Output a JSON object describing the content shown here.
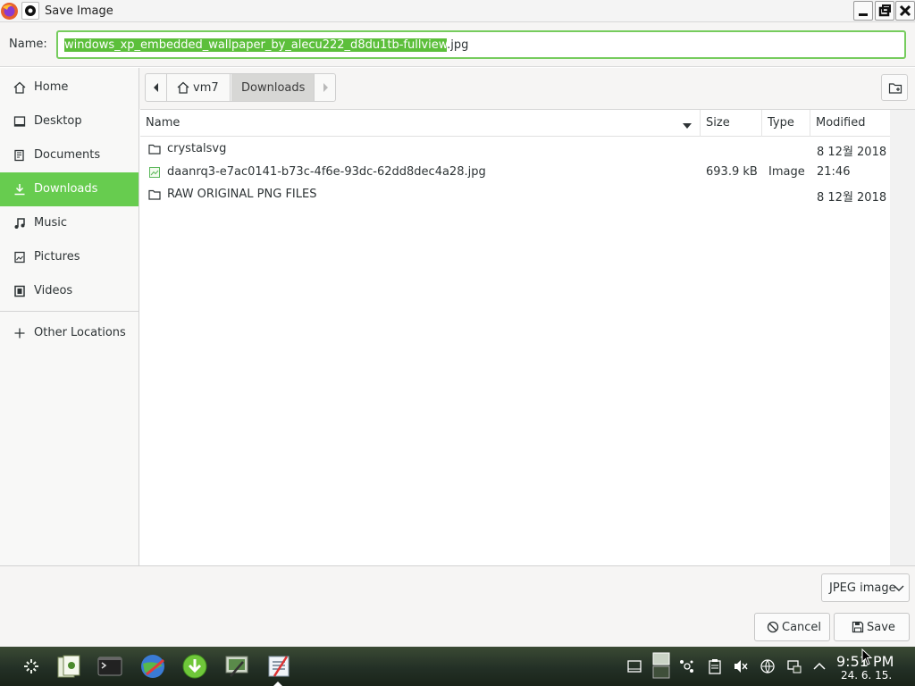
{
  "window": {
    "title": "Save Image"
  },
  "name_field": {
    "label": "Name:",
    "value_selected": "windows_xp_embedded_wallpaper_by_alecu222_d8du1tb-fullview",
    "value_rest": ".jpg"
  },
  "sidebar": {
    "items": [
      {
        "label": "Home",
        "icon": "home-icon"
      },
      {
        "label": "Desktop",
        "icon": "desktop-icon"
      },
      {
        "label": "Documents",
        "icon": "documents-icon"
      },
      {
        "label": "Downloads",
        "icon": "downloads-icon",
        "active": true
      },
      {
        "label": "Music",
        "icon": "music-icon"
      },
      {
        "label": "Pictures",
        "icon": "pictures-icon"
      },
      {
        "label": "Videos",
        "icon": "videos-icon"
      },
      {
        "label": "Other Locations",
        "icon": "plus-icon"
      }
    ]
  },
  "pathbar": {
    "home_label": "vm7",
    "current_label": "Downloads"
  },
  "file_list": {
    "columns": {
      "name": "Name",
      "size": "Size",
      "type": "Type",
      "modified": "Modified"
    },
    "rows": [
      {
        "name": "crystalsvg",
        "icon": "folder-icon",
        "size": "",
        "type": "",
        "modified": "8 12월 2018"
      },
      {
        "name": "daanrq3-e7ac0141-b73c-4f6e-93dc-62dd8dec4a28.jpg",
        "icon": "image-file-icon",
        "size": "693.9 kB",
        "type": "Image",
        "modified": "21:46"
      },
      {
        "name": "RAW ORIGINAL PNG FILES",
        "icon": "folder-icon",
        "size": "",
        "type": "",
        "modified": "8 12월 2018"
      }
    ]
  },
  "bottom": {
    "file_type": "JPEG image",
    "cancel_label": "Cancel",
    "save_label": "Save"
  },
  "taskbar": {
    "clock_time": "9:51 PM",
    "clock_date": "24. 6. 15."
  },
  "colors": {
    "accent": "#67cc4f",
    "selection": "#5cbf3b",
    "taskbar": "#233026"
  }
}
